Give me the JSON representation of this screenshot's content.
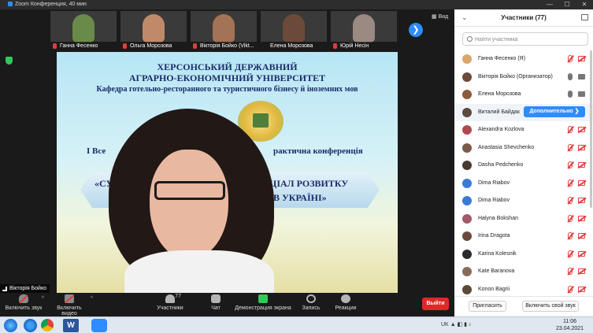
{
  "window": {
    "title": "Zoom Конференция, 40 мин",
    "controls": [
      "—",
      "☐",
      "✕"
    ]
  },
  "thumbnails": [
    {
      "name": "Ганна Фесенко",
      "color": "#6a8a4a",
      "muted": true
    },
    {
      "name": "Ольга Морозова",
      "color": "#c08a6a",
      "muted": true
    },
    {
      "name": "Вікторія Бойко (Vikt...",
      "color": "#a27354",
      "muted": true
    },
    {
      "name": "Елена Морозова",
      "color": "#6b4a3a",
      "muted": false
    },
    {
      "name": "Юрій Несін",
      "color": "#9b8a82",
      "muted": true
    }
  ],
  "view_label": "Вид",
  "slide": {
    "line1": "ХЕРСОНСЬКИЙ ДЕРЖАВНИЙ",
    "line2": "АГРАРНО-ЕКОНОМІЧНИЙ УНІВЕРСИТЕТ",
    "line3": "Кафедра готельно-ресторанного та туристичного бізнесу й іноземних мов",
    "line4a": "I Все",
    "line4b": "рактична конференція",
    "line5a": "«СУ",
    "line5b": "ЦІАЛ РОЗВИТКУ",
    "line6": "В УКРАЇНІ»"
  },
  "active_speaker": "Вікторія Бойко",
  "toolbar": {
    "audio": "Включить звук",
    "video": "Включить видео",
    "participants": "Участники",
    "participants_count": "77",
    "chat": "Чат",
    "share": "Демонстрация экрана",
    "record": "Запись",
    "reactions": "Реакции",
    "leave": "Выйти"
  },
  "panel": {
    "title": "Участники (77)",
    "search_placeholder": "Найти участника",
    "more_button": "Дополнительно ❯",
    "invite": "Пригласить",
    "unmute_me": "Включить свой звук",
    "participants": [
      {
        "name": "Ганна Фесенко (Я)",
        "avatar": "#d9a66c",
        "mic": "off",
        "cam": "off"
      },
      {
        "name": "Вікторія Бойко (Организатор)",
        "avatar": "#6b4a3a",
        "mic": "on",
        "cam": "on"
      },
      {
        "name": "Елена Морозова",
        "avatar": "#8a5a3a",
        "mic": "on",
        "cam": "on"
      },
      {
        "name": "Виталий Байдак",
        "avatar": "#5a4a40",
        "mic": "off",
        "cam": "off",
        "hover": true
      },
      {
        "name": "Alexandra Kozlova",
        "avatar": "#b04a50",
        "mic": "off",
        "cam": "off"
      },
      {
        "name": "Anastasia Shevchenko",
        "avatar": "#7a5a48",
        "mic": "off",
        "cam": "off"
      },
      {
        "name": "Dasha Pedchenko",
        "avatar": "#4a3a30",
        "mic": "off",
        "cam": "off"
      },
      {
        "name": "Dima Riabov",
        "avatar": "#3a7bd5",
        "mic": "off",
        "cam": "off"
      },
      {
        "name": "Dima Riabov",
        "avatar": "#3a7bd5",
        "mic": "off",
        "cam": "off"
      },
      {
        "name": "Halyna Bokshan",
        "avatar": "#a05a6a",
        "mic": "off",
        "cam": "off"
      },
      {
        "name": "Irina Dragota",
        "avatar": "#6a4a3a",
        "mic": "off",
        "cam": "off"
      },
      {
        "name": "Karina Kolesnik",
        "avatar": "#2a2a2a",
        "mic": "off",
        "cam": "off"
      },
      {
        "name": "Kate Baranova",
        "avatar": "#8a6a5a",
        "mic": "off",
        "cam": "off"
      },
      {
        "name": "Konon Bagrii",
        "avatar": "#5a4a3a",
        "mic": "off",
        "cam": "off"
      }
    ]
  },
  "taskbar": {
    "lang": "UK",
    "time": "11:06",
    "date": "23.04.2021"
  },
  "colors": {
    "accent": "#2d8cff",
    "danger": "#e02828",
    "muted_icon": "#e03e3e",
    "share_green": "#34c759"
  }
}
